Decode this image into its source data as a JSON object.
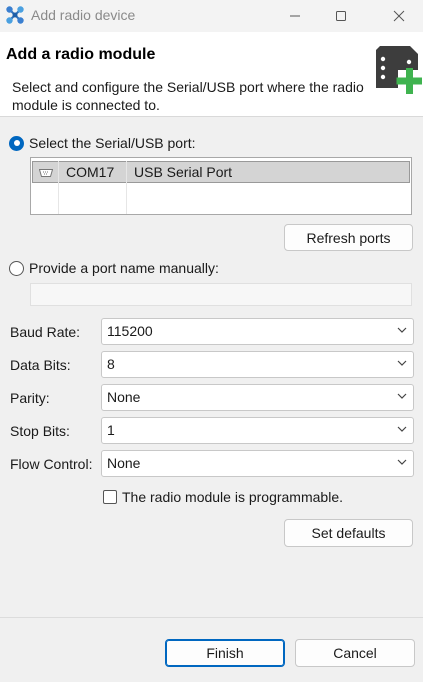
{
  "window": {
    "title": "Add radio device",
    "icon": "network-nodes-icon"
  },
  "header": {
    "title": "Add a radio module",
    "description": "Select and configure the Serial/USB port where the radio module is connected to.",
    "icon": "radio-module-add-icon"
  },
  "serial_port": {
    "radio_label": "Select the Serial/USB port:",
    "selected": true,
    "ports": [
      {
        "name": "COM17",
        "description": "USB Serial Port",
        "selected": true
      }
    ],
    "refresh_label": "Refresh ports"
  },
  "manual_port": {
    "radio_label": "Provide a port name manually:",
    "selected": false,
    "value": ""
  },
  "settings": {
    "baud_rate": {
      "label": "Baud Rate:",
      "value": "115200"
    },
    "data_bits": {
      "label": "Data Bits:",
      "value": "8"
    },
    "parity": {
      "label": "Parity:",
      "value": "None"
    },
    "stop_bits": {
      "label": "Stop Bits:",
      "value": "1"
    },
    "flow_control": {
      "label": "Flow Control:",
      "value": "None"
    }
  },
  "programmable": {
    "label": "The radio module is programmable.",
    "checked": false
  },
  "set_defaults_label": "Set defaults",
  "footer": {
    "finish_label": "Finish",
    "cancel_label": "Cancel"
  },
  "colors": {
    "accent": "#0067c0",
    "module_green": "#3fb34f",
    "module_dark": "#3d3d3d"
  }
}
